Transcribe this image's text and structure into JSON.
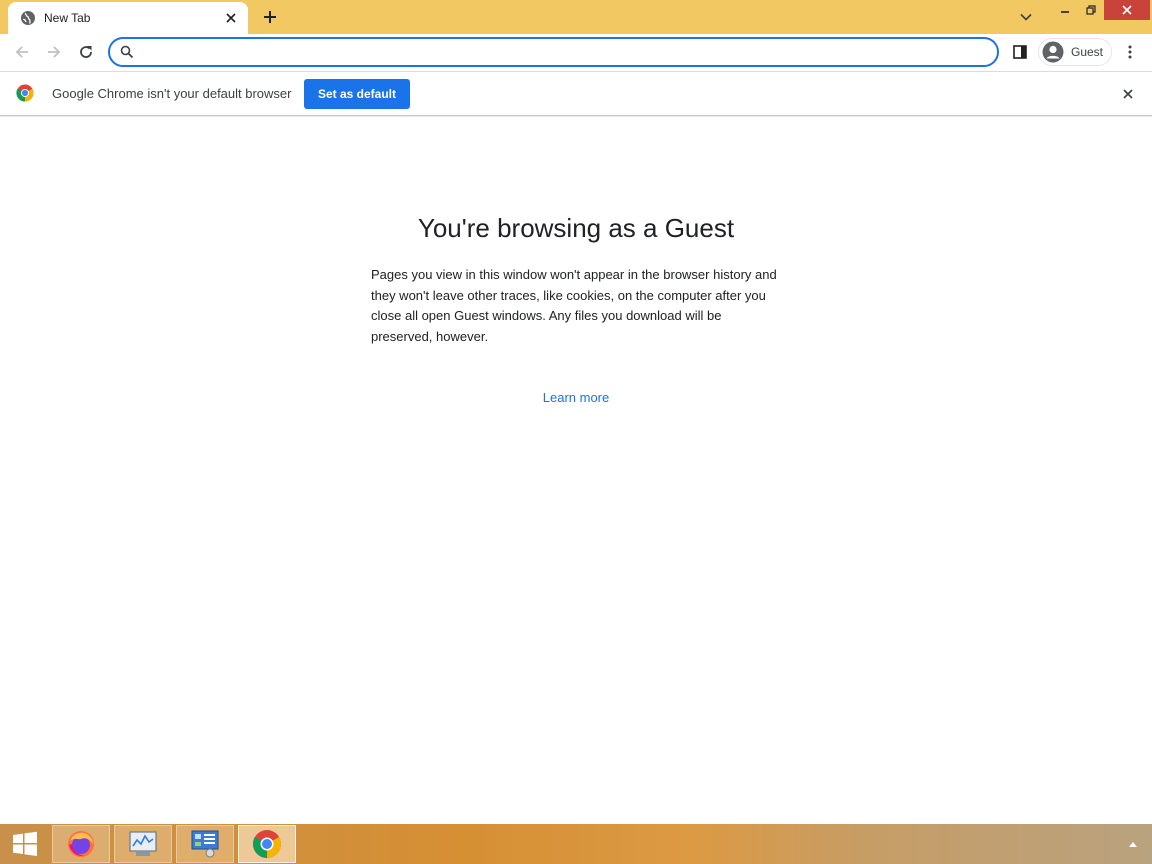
{
  "browser": {
    "tab": {
      "title": "New Tab",
      "favicon": "globe-icon"
    },
    "omnibox": {
      "value": "",
      "placeholder": ""
    },
    "profile": {
      "label": "Guest"
    },
    "colors": {
      "frame": "#f1c862",
      "accent": "#1a73e8",
      "close_button": "#c8443a"
    }
  },
  "infobar": {
    "message": "Google Chrome isn't your default browser",
    "button_label": "Set as default"
  },
  "page": {
    "heading": "You're browsing as a Guest",
    "description": "Pages you view in this window won't appear in the browser history and they won't leave other traces, like cookies, on the computer after you close all open Guest windows. Any files you download will be preserved, however.",
    "learn_more": "Learn more"
  },
  "taskbar": {
    "items": [
      {
        "icon": "firefox-icon"
      },
      {
        "icon": "system-monitor-icon"
      },
      {
        "icon": "control-panel-icon"
      },
      {
        "icon": "chrome-icon",
        "active": true
      }
    ]
  }
}
